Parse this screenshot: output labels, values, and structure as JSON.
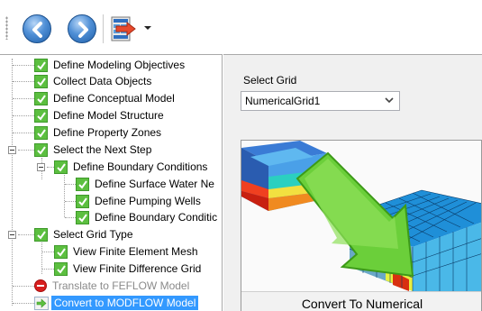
{
  "toolbar": {
    "back_icon": "back-arrow-icon",
    "forward_icon": "forward-arrow-icon",
    "convert_icon": "convert-grid-icon",
    "dropdown_icon": "dropdown-arrow-icon"
  },
  "tree": {
    "items": [
      {
        "label": "Define Modeling Objectives",
        "state": "checked"
      },
      {
        "label": "Collect Data Objects",
        "state": "checked"
      },
      {
        "label": "Define  Conceptual Model",
        "state": "checked"
      },
      {
        "label": "Define  Model Structure",
        "state": "checked"
      },
      {
        "label": "Define  Property Zones",
        "state": "checked"
      },
      {
        "label": "Select the Next Step",
        "state": "checked"
      },
      {
        "label": "Define Boundary Conditions",
        "state": "checked"
      },
      {
        "label": "Define Surface Water Ne",
        "state": "checked"
      },
      {
        "label": "Define Pumping Wells",
        "state": "checked"
      },
      {
        "label": "Define Boundary Conditic",
        "state": "checked"
      },
      {
        "label": "Select Grid Type",
        "state": "checked"
      },
      {
        "label": "View Finite Element Mesh",
        "state": "checked"
      },
      {
        "label": "View Finite Difference Grid",
        "state": "checked"
      },
      {
        "label": "Translate to FEFLOW Model",
        "state": "disabled"
      },
      {
        "label": "Convert to MODFLOW Model",
        "state": "selected"
      }
    ]
  },
  "panel": {
    "select_label": "Select Grid",
    "select_value": "NumericalGrid1",
    "preview_caption": "Convert To Numerical"
  },
  "colors": {
    "check_green": "#5cbf40",
    "selection_blue": "#3399ff",
    "disabled_grey": "#8a8a8a"
  }
}
